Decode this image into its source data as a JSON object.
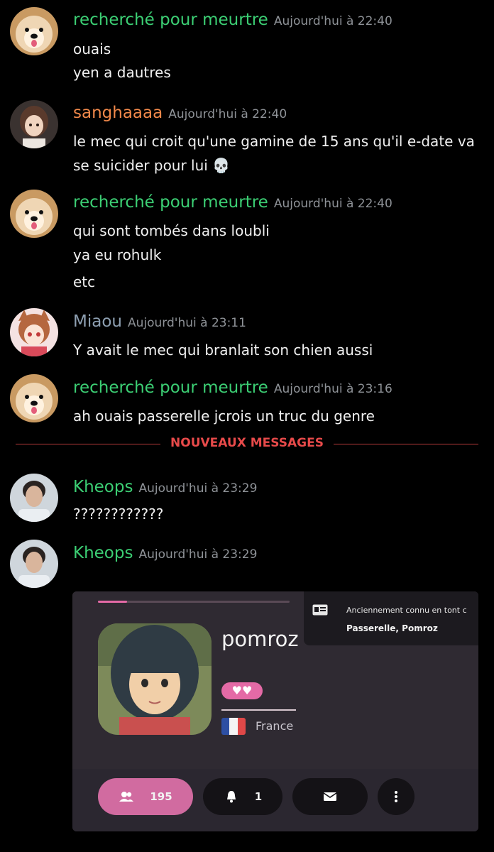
{
  "colors": {
    "green_user": "#3ccf74",
    "orange_user": "#f0884a",
    "grey_user": "#8ea0b2",
    "timestamp": "#8e9297",
    "new_divider": "#e84a4a",
    "accent_pink": "#e46aa6"
  },
  "messages": [
    {
      "username": "recherché pour meurtre",
      "timestamp": "Aujourd'hui à 22:40",
      "lines": [
        "ouais",
        "yen a dautres"
      ],
      "avatar": "dog-avatar"
    },
    {
      "username": "sanghaaaa",
      "timestamp": "Aujourd'hui à 22:40",
      "lines": [
        "le mec qui croit qu'une gamine de 15 ans qu'il e-date va",
        "se suicider pour lui 💀"
      ],
      "avatar": "anime-girl-avatar"
    },
    {
      "username": "recherché pour meurtre",
      "timestamp": "Aujourd'hui à 22:40",
      "lines": [
        "qui sont tombés dans loubli",
        "ya eu rohulk",
        "etc"
      ],
      "avatar": "dog-avatar"
    },
    {
      "username": "Miaou",
      "timestamp": "Aujourd'hui à 23:11",
      "lines": [
        "Y avait le mec qui branlait son chien aussi"
      ],
      "avatar": "anime-catgirl-avatar"
    },
    {
      "username": "recherché pour meurtre",
      "timestamp": "Aujourd'hui à 23:16",
      "lines": [
        "ah ouais passerelle jcrois un truc du genre"
      ],
      "avatar": "dog-avatar"
    },
    {
      "username": "Kheops",
      "timestamp": "Aujourd'hui à 23:29",
      "lines": [
        "????????????"
      ],
      "avatar": "man-photo-avatar"
    },
    {
      "username": "Kheops",
      "timestamp": "Aujourd'hui à 23:29",
      "lines": [],
      "avatar": "man-photo-avatar"
    }
  ],
  "divider_label": "NOUVEAUX MESSAGES",
  "embed": {
    "profile_name": "pomroz",
    "heart_badge": "♥♥",
    "country": "France",
    "tooltip_line1": "Anciennement connu en tont c",
    "tooltip_line2": "Passerelle, Pomroz",
    "followers": "195",
    "notifications": "1",
    "progress_fraction": 0.15,
    "icons": [
      "id-card-icon",
      "users-icon",
      "bell-icon",
      "mail-icon",
      "more-dots-icon"
    ]
  }
}
